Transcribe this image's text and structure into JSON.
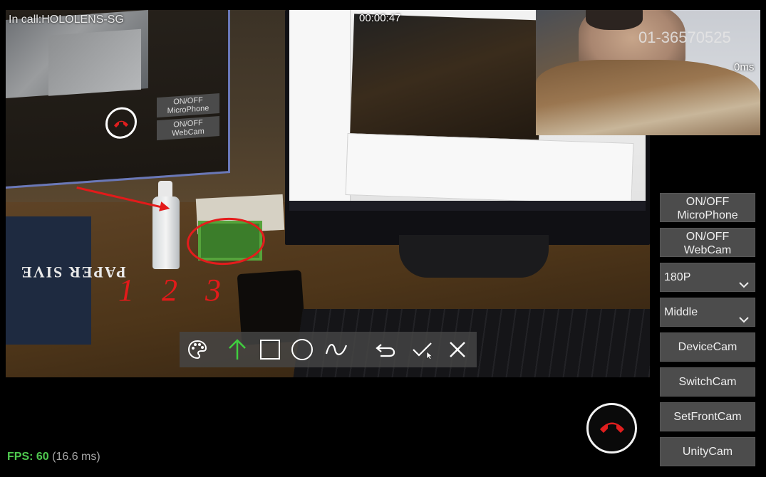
{
  "call": {
    "label": "In call:HOLOLENS-SG",
    "timer": "00:00:47"
  },
  "self_view": {
    "device_id": "01-36570525",
    "latency": "0ms"
  },
  "hologram_panel": {
    "microphone_label": "ON/OFF\nMicroPhone",
    "webcam_label": "ON/OFF\nWebCam"
  },
  "scene": {
    "annotation_text": "1 2 3",
    "book_text": "PAPER  SIVE"
  },
  "toolbar": {
    "tools": [
      {
        "name": "palette",
        "icon": "palette-icon"
      },
      {
        "name": "arrow",
        "icon": "arrow-up-icon",
        "color": "#3fcf3f"
      },
      {
        "name": "rectangle",
        "icon": "square-icon"
      },
      {
        "name": "circle",
        "icon": "circle-icon"
      },
      {
        "name": "freehand",
        "icon": "wave-icon"
      },
      {
        "name": "undo",
        "icon": "undo-icon"
      },
      {
        "name": "confirm",
        "icon": "check-icon"
      },
      {
        "name": "close",
        "icon": "close-icon"
      }
    ]
  },
  "controls": {
    "microphone": {
      "line1": "ON/OFF",
      "line2": "MicroPhone"
    },
    "webcam": {
      "line1": "ON/OFF",
      "line2": "WebCam"
    },
    "resolution": {
      "value": "180P"
    },
    "position": {
      "value": "Middle"
    },
    "device_cam": "DeviceCam",
    "switch_cam": "SwitchCam",
    "set_front_cam": "SetFrontCam",
    "unity_cam": "UnityCam"
  },
  "hangup": {
    "icon": "phone-hangup-icon",
    "color": "#e01e1e"
  },
  "fps": {
    "label": "FPS: 60",
    "detail": "(16.6 ms)"
  }
}
